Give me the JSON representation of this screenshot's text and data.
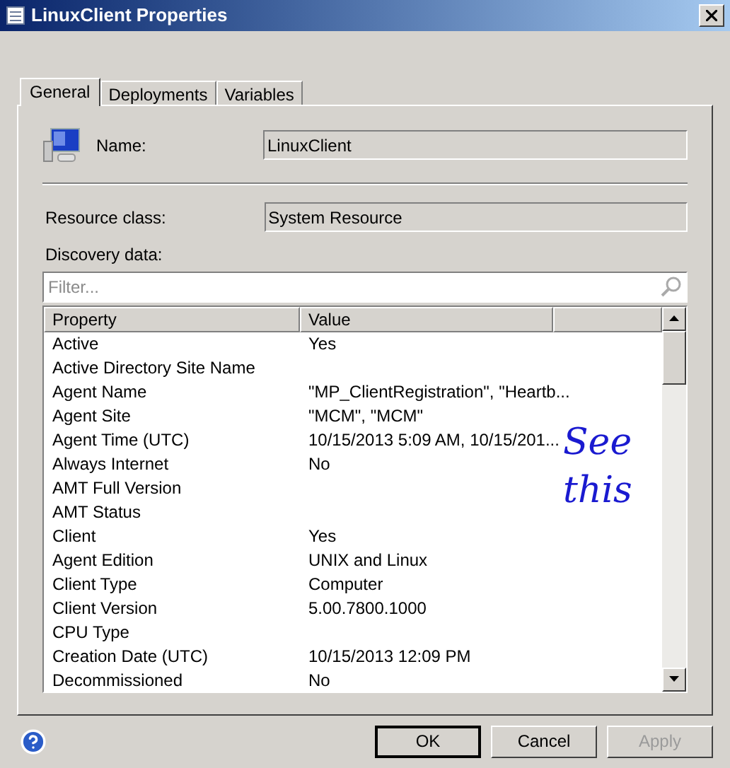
{
  "window": {
    "title": "LinuxClient Properties"
  },
  "tabs": [
    {
      "label": "General",
      "selected": true
    },
    {
      "label": "Deployments",
      "selected": false
    },
    {
      "label": "Variables",
      "selected": false
    }
  ],
  "name": {
    "label": "Name:",
    "value": "LinuxClient"
  },
  "resource_class": {
    "label": "Resource class:",
    "value": "System Resource"
  },
  "discovery": {
    "label": "Discovery data:",
    "filter": {
      "placeholder": "Filter..."
    },
    "columns": [
      "Property",
      "Value"
    ],
    "rows": [
      {
        "property": "Active",
        "value": "Yes"
      },
      {
        "property": "Active Directory Site Name",
        "value": ""
      },
      {
        "property": "Agent Name",
        "value": "\"MP_ClientRegistration\", \"Heartb..."
      },
      {
        "property": "Agent Site",
        "value": "\"MCM\", \"MCM\""
      },
      {
        "property": "Agent Time (UTC)",
        "value": "10/15/2013 5:09 AM, 10/15/201..."
      },
      {
        "property": "Always Internet",
        "value": "No"
      },
      {
        "property": "AMT Full Version",
        "value": ""
      },
      {
        "property": "AMT Status",
        "value": ""
      },
      {
        "property": "Client",
        "value": "Yes"
      },
      {
        "property": "Agent Edition",
        "value": "UNIX and Linux"
      },
      {
        "property": "Client Type",
        "value": "Computer"
      },
      {
        "property": "Client Version",
        "value": "5.00.7800.1000"
      },
      {
        "property": "CPU Type",
        "value": ""
      },
      {
        "property": "Creation Date (UTC)",
        "value": "10/15/2013 12:09 PM"
      },
      {
        "property": "Decommissioned",
        "value": "No"
      }
    ]
  },
  "annotation": {
    "text": "See this"
  },
  "buttons": [
    {
      "label": "OK",
      "default": true,
      "disabled": false
    },
    {
      "label": "Cancel",
      "default": false,
      "disabled": false
    },
    {
      "label": "Apply",
      "default": false,
      "disabled": true
    }
  ]
}
